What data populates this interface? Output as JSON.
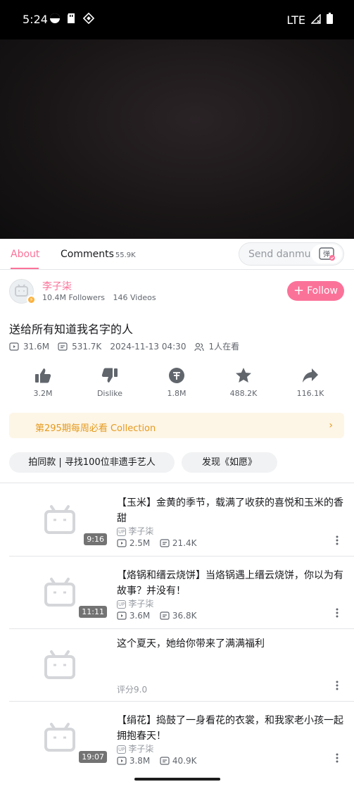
{
  "status_bar": {
    "time": "5:24",
    "network": "LTE"
  },
  "tabs": [
    {
      "label": "About"
    },
    {
      "label": "Comments",
      "count": "55.9K"
    }
  ],
  "danmu": {
    "placeholder": "Send danmu",
    "button": "弹"
  },
  "uploader": {
    "name": "李子柒",
    "followers": "10.4M Followers",
    "videos": "146 Videos",
    "follow_label": "Follow",
    "follow_plus": "+"
  },
  "video": {
    "title": "送给所有知道我名字的人",
    "views": "31.6M",
    "danmaku": "531.7K",
    "datetime": "2024-11-13 04:30",
    "watching": "1人在看"
  },
  "actions": [
    {
      "icon": "like-icon",
      "label": "3.2M"
    },
    {
      "icon": "dislike-icon",
      "label": "Dislike"
    },
    {
      "icon": "coin-icon",
      "label": "1.8M"
    },
    {
      "icon": "star-icon",
      "label": "488.2K"
    },
    {
      "icon": "share-icon",
      "label": "116.1K"
    }
  ],
  "collection": {
    "text": "第295期每周必看 Collection",
    "arrow": "›"
  },
  "chips": [
    {
      "label": "拍同款 | 寻找100位非遗手艺人"
    },
    {
      "label": "发现《如愿》"
    }
  ],
  "recommendations": [
    {
      "title": "【玉米】金黄的季节，载满了收获的喜悦和玉米的香甜",
      "duration": "9:16",
      "uploader": "李子柒",
      "views": "2.5M",
      "danmaku": "21.4K"
    },
    {
      "title": "【烙锅和缙云烧饼】当烙锅遇上缙云烧饼，你以为有故事？并没有！",
      "duration": "11:11",
      "uploader": "李子柒",
      "views": "3.6M",
      "danmaku": "36.8K"
    },
    {
      "title": "这个夏天，她给你带来了满满福利",
      "score": "评分9.0"
    },
    {
      "title": "【绢花】捣鼓了一身看花的衣裳，和我家老小孩一起拥抱春天！",
      "duration": "19:07",
      "uploader": "李子柒",
      "views": "3.8M",
      "danmaku": "40.9K"
    }
  ],
  "colors": {
    "accent": "#fb7299",
    "collection_bg": "#fdf5e6",
    "collection_text": "#e59a1c"
  }
}
